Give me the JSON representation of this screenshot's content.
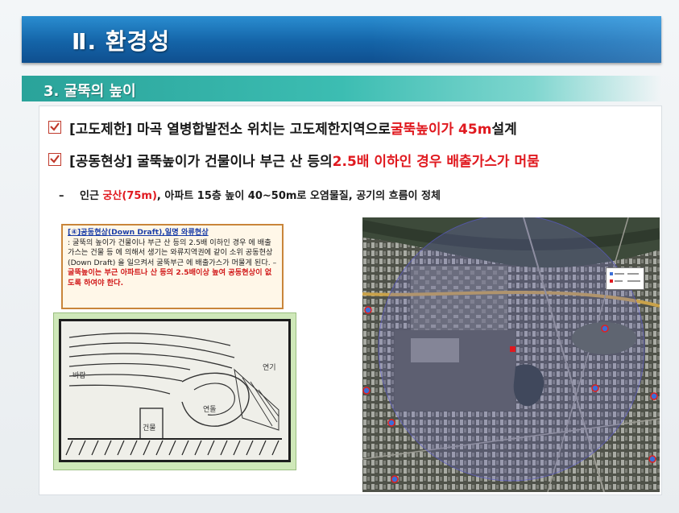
{
  "title": "Ⅱ. 환경성",
  "section": "3. 굴뚝의 높이",
  "bullets": [
    {
      "prefix": "[고도제한] 마곡 열병합발전소 위치는 고도제한지역으로 ",
      "highlight": "굴뚝높이가 45m",
      "suffix": " 설계"
    },
    {
      "prefix": "[공동현상] 굴뚝높이가 건물이나 부근 산 등의 ",
      "highlight": "2.5배 이하인 경우 배출가스가 머뭄",
      "suffix": ""
    }
  ],
  "sub_bullet": {
    "dash": "–",
    "prefix": "인근 ",
    "highlight": "궁산(75m)",
    "suffix": ", 아파트 15층 높이 40~50m로 오염물질, 공기의 흐름이 정체"
  },
  "explain": {
    "head": "[④]공동현상(Down Draft),일명 와류현상",
    "body": ": 굴뚝의 높이가 건물이나 부근 산 등의 2.5배 이하인 경우 에 배출 가스는 건물 등 에 의해서 생기는 와류지역권에 같이 소위 공동현상 (Down Draft) 을 일으켜서 굴뚝부근 에 배출가스가 머물게 된다. – ",
    "red": "굴뚝높이는 부근 아파트나 산 등의 2.5배이상 높여 공동현상이 없도록 하여야 한다."
  },
  "diagram": {
    "labels": {
      "wind": "바람",
      "building": "건물",
      "smoke": "연기",
      "vortex": "연돌"
    }
  },
  "colors": {
    "title_bar": "#1464a8",
    "section_bar": "#2aa39a",
    "highlight": "#e0191f",
    "explain_border": "#c9853a"
  }
}
